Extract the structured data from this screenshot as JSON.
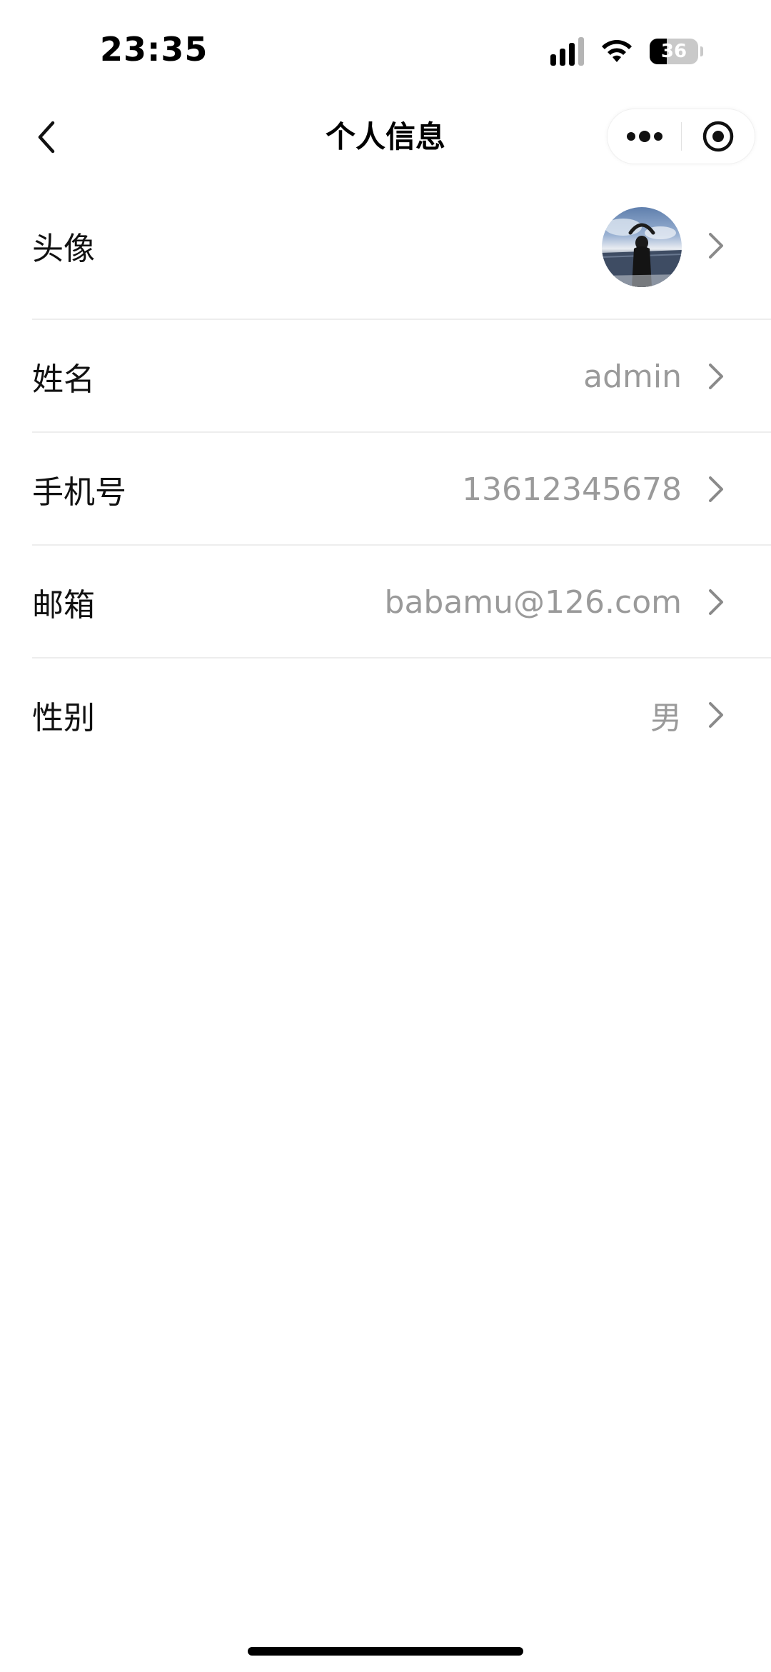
{
  "status_bar": {
    "time": "23:35",
    "battery_level": "36",
    "battery_percent": 36,
    "signal_bars_total": 4,
    "signal_bars_active": 3,
    "icons": [
      "signal-icon",
      "wifi-icon",
      "battery-icon"
    ]
  },
  "nav": {
    "title": "个人信息",
    "back_icon": "chevron-left-icon",
    "more_icon": "more-dots-icon",
    "close_icon": "target-circle-icon"
  },
  "profile": {
    "avatar": {
      "label": "头像"
    },
    "fields": [
      {
        "label": "姓名",
        "value": "admin"
      },
      {
        "label": "手机号",
        "value": "13612345678"
      },
      {
        "label": "邮箱",
        "value": "babamu@126.com"
      },
      {
        "label": "性别",
        "value": "男"
      }
    ],
    "chevron_icon": "chevron-right-icon"
  },
  "colors": {
    "text_primary": "#111111",
    "text_secondary": "#9a9a9a",
    "divider": "#ededed",
    "background": "#ffffff"
  }
}
